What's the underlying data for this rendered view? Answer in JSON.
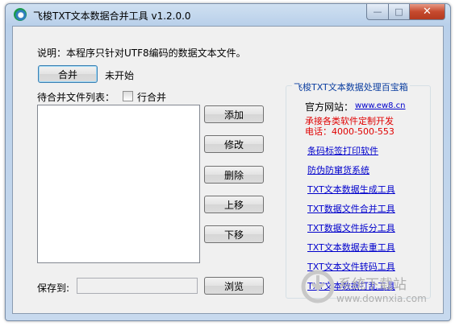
{
  "window": {
    "title": "飞梭TXT文本数据合并工具 v1.2.0.0"
  },
  "caption": {
    "minimize": "—",
    "maximize": "□",
    "close": "✕"
  },
  "main": {
    "description": "说明：本程序只针对UTF8编码的数据文本文件。",
    "merge_button": "合并",
    "status": "未开始",
    "file_list_label": "待合并文件列表：",
    "line_merge_label": "行合并",
    "buttons": {
      "add": "添加",
      "modify": "修改",
      "delete": "删除",
      "up": "上移",
      "down": "下移",
      "browse": "浏览"
    },
    "save_label": "保存到:",
    "save_path": ""
  },
  "sidebar": {
    "group_title": "飞梭TXT文本数据处理百宝箱",
    "website_label": "官方网站：",
    "website_url": "www.ew8.cn",
    "custom_dev": "承接各类软件定制开发",
    "phone": "电话：4000-500-553",
    "links": [
      "条码标签打印软件",
      "防伪防窜货系统",
      "TXT文本数据生成工具",
      "TXT数据文件合并工具",
      "TXT数据文件拆分工具",
      "TXT文本数据去重工具",
      "TXT文本文件转码工具",
      "TXT文本数据打乱工具"
    ]
  },
  "watermark": {
    "text1": "系统下载站",
    "text2": "www.downxia.com"
  }
}
